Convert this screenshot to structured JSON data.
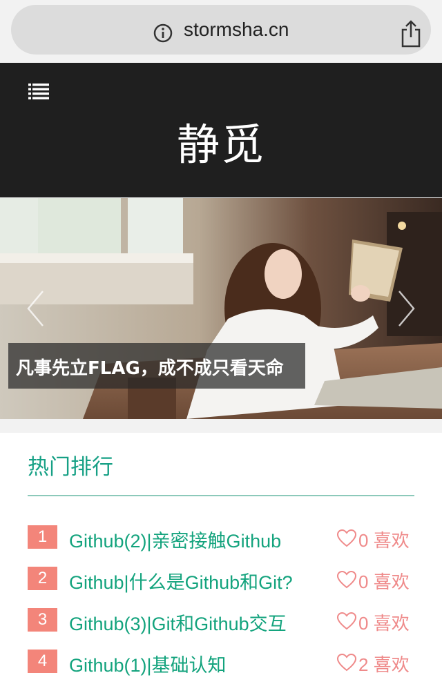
{
  "browser": {
    "url": "stormsha.cn",
    "info_icon": "info-icon",
    "share_icon": "share-icon"
  },
  "header": {
    "menu_icon": "list-icon",
    "site_title": "静觅"
  },
  "banner": {
    "caption": "凡事先立FLAG，成不成只看天命",
    "prev_icon": "chevron-left-icon",
    "next_icon": "chevron-right-icon"
  },
  "hot": {
    "title": "热门排行",
    "like_suffix": "喜欢",
    "items": [
      {
        "rank": "1",
        "title": "Github(2)|亲密接触Github",
        "likes": "0"
      },
      {
        "rank": "2",
        "title": "Github|什么是Github和Git?",
        "likes": "0"
      },
      {
        "rank": "3",
        "title": "Github(3)|Git和Github交互",
        "likes": "0"
      },
      {
        "rank": "4",
        "title": "Github(1)|基础认知",
        "likes": "2"
      }
    ]
  },
  "colors": {
    "accent": "#16a085",
    "rank_badge": "#f3857a",
    "like": "#ef8a8a",
    "header_bg": "#1f1f1f"
  }
}
